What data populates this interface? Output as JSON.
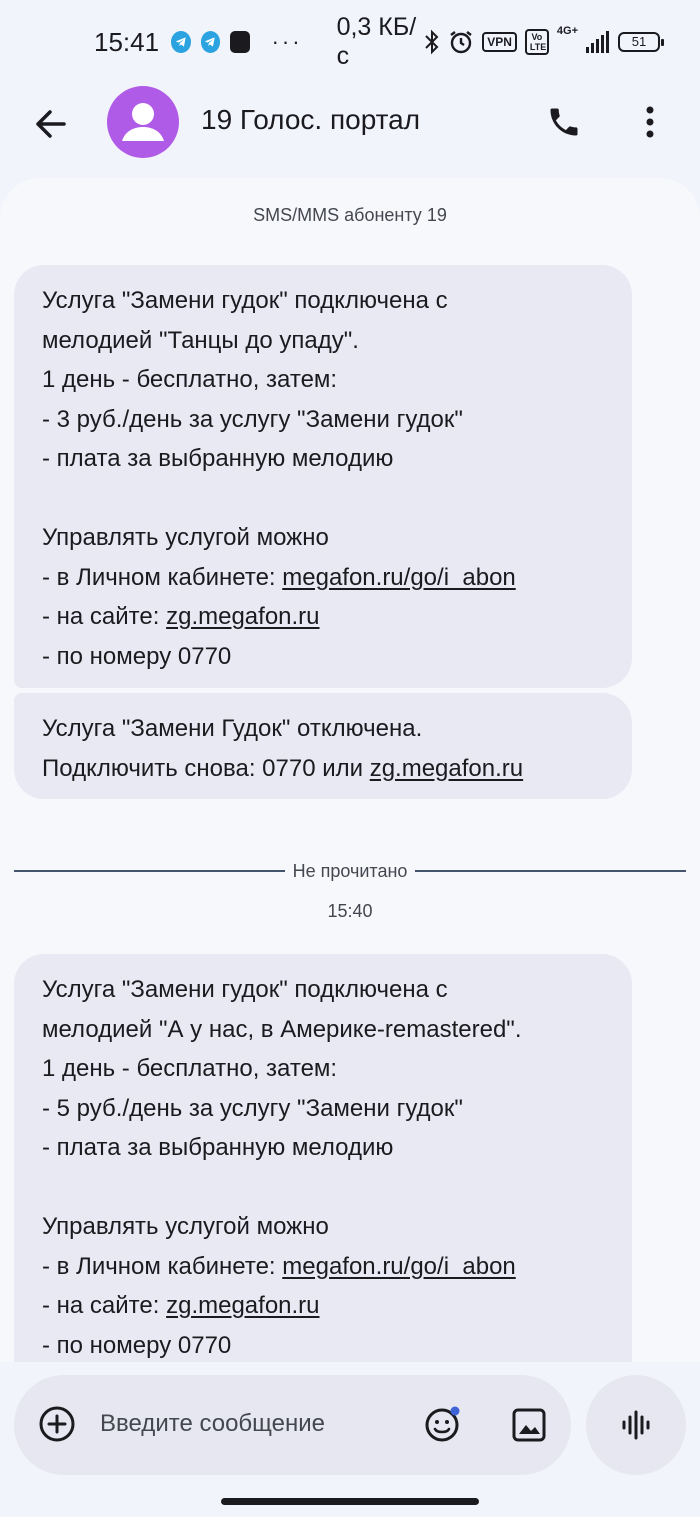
{
  "status_bar": {
    "time": "15:41",
    "notification_icons": [
      "telegram-icon",
      "telegram-icon",
      "app-icon"
    ],
    "more": "···",
    "speed": "0,3 КБ/с",
    "vpn": "VPN",
    "volte": "Vo LTE",
    "network": "4G+",
    "battery": "51"
  },
  "header": {
    "contact_name": "19 Голос. портал"
  },
  "conversation": {
    "subscriber_label": "SMS/MMS абоненту 19",
    "messages": [
      {
        "lines": [
          "Услуга \"Замени гудок\" подключена с",
          "мелодией \"Танцы до упаду\".",
          "1 день - бесплатно, затем:",
          "- 3 руб./день за услугу \"Замени гудок\"",
          "- плата за выбранную мелодию",
          "",
          "Управлять услугой можно",
          "- в Личном кабинете: ",
          "- на сайте: ",
          "- по номеру 0770"
        ],
        "link_cabinet": "megafon.ru/go/i_abon",
        "link_site": "zg.megafon.ru"
      },
      {
        "line1": "Услуга \"Замени Гудок\" отключена.",
        "line2": "Подключить снова: 0770 или ",
        "link_site": "zg.megafon.ru"
      },
      {
        "lines": [
          "Услуга \"Замени гудок\" подключена с",
          "мелодией \"А у нас, в Америке-remastered\".",
          "1 день - бесплатно, затем:",
          "- 5 руб./день за услугу \"Замени гудок\"",
          "- плата за выбранную мелодию",
          "",
          "Управлять услугой можно",
          "- в Личном кабинете: ",
          "- на сайте: ",
          "- по номеру 0770"
        ],
        "link_cabinet": "megafon.ru/go/i_abon",
        "link_site": "zg.megafon.ru"
      }
    ],
    "unread_label": "Не прочитано",
    "timestamp": "15:40"
  },
  "compose": {
    "placeholder": "Введите сообщение"
  },
  "colors": {
    "avatar": "#b05ae8",
    "bubble": "#e8e9f3",
    "background": "#f2f4fb",
    "panel": "#f7f8fc"
  }
}
